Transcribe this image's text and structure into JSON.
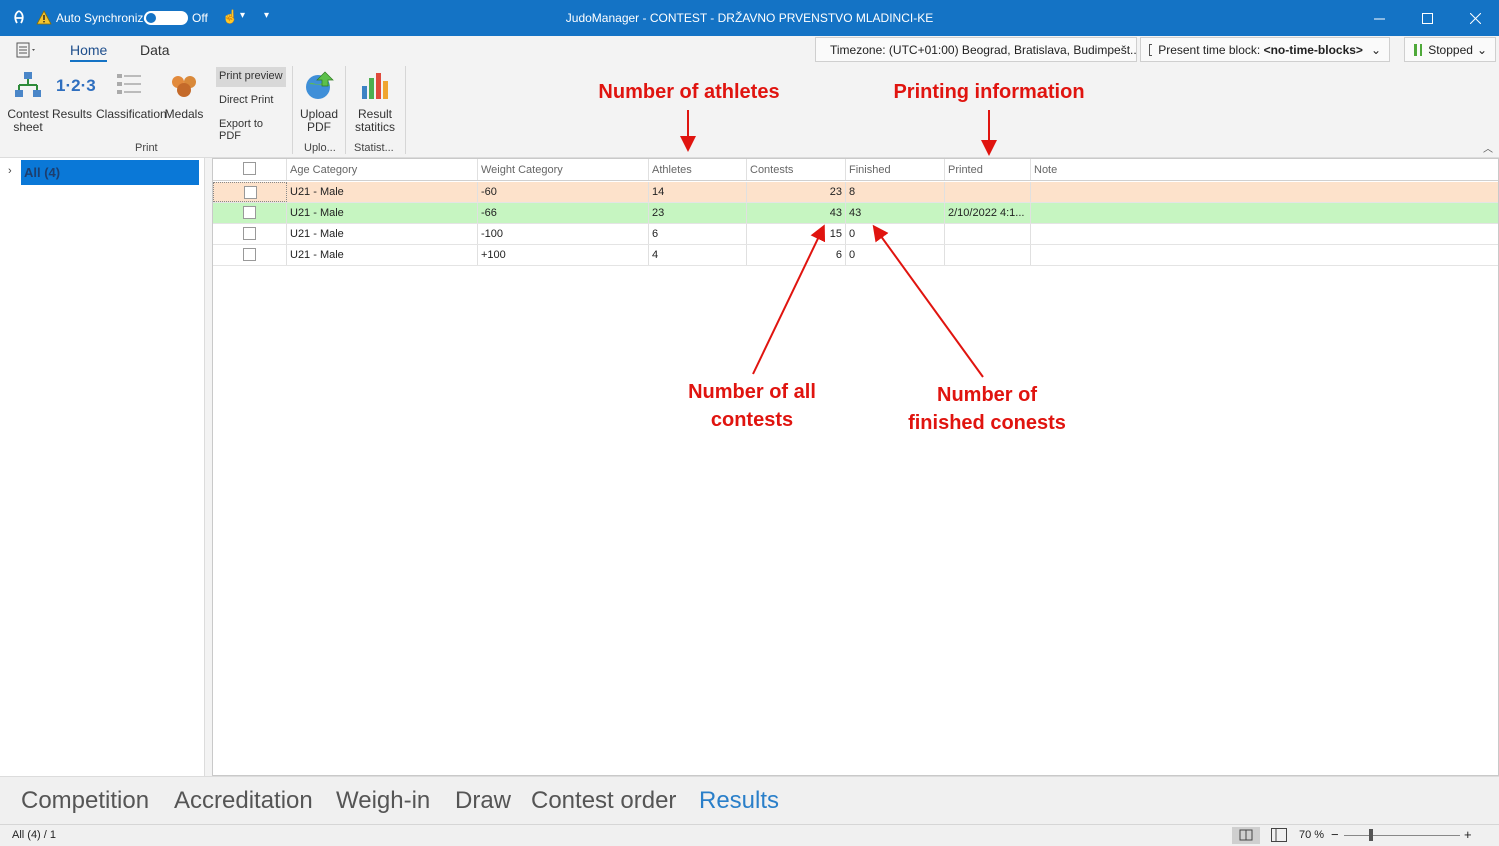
{
  "titlebar": {
    "auto_sync_label": "Auto Synchronize",
    "auto_sync_state": "Off",
    "title": "JudoManager - CONTEST - DRŽAVNO PRVENSTVO MLADINCI-KE"
  },
  "ribbon": {
    "tabs": [
      "Home",
      "Data"
    ],
    "timezone": "Timezone: (UTC+01:00) Beograd, Bratislava, Budimpešt...",
    "time_block_label": "Present time block:",
    "time_block_value": "<no-time-blocks>",
    "status": "Stopped",
    "print_group": {
      "caption": "Print",
      "buttons": [
        "Contest sheet",
        "Results",
        "Classification",
        "Medals"
      ],
      "options": [
        "Print preview",
        "Direct Print",
        "Export to PDF"
      ]
    },
    "upload_group": {
      "caption": "Uplo...",
      "button": "Upload PDF"
    },
    "stats_group": {
      "caption": "Statist...",
      "button": "Result statitics"
    }
  },
  "tree": {
    "item": "All (4)"
  },
  "grid": {
    "columns": [
      "Age Category",
      "Weight Category",
      "Athletes",
      "Contests",
      "Finished",
      "Printed",
      "Note"
    ],
    "rows": [
      {
        "age": "U21 - Male",
        "weight": "-60",
        "athletes": "14",
        "contests": "23",
        "finished": "8",
        "printed": "",
        "note": ""
      },
      {
        "age": "U21 - Male",
        "weight": "-66",
        "athletes": "23",
        "contests": "43",
        "finished": "43",
        "printed": "2/10/2022 4:1...",
        "note": ""
      },
      {
        "age": "U21 - Male",
        "weight": "-100",
        "athletes": "6",
        "contests": "15",
        "finished": "0",
        "printed": "",
        "note": ""
      },
      {
        "age": "U21 - Male",
        "weight": "+100",
        "athletes": "4",
        "contests": "6",
        "finished": "0",
        "printed": "",
        "note": ""
      }
    ]
  },
  "annotations": {
    "athletes": "Number of athletes",
    "printing": "Printing information",
    "all_contests_1": "Number of all",
    "all_contests_2": "contests",
    "finished_1": "Number of",
    "finished_2": "finished conests"
  },
  "nav": [
    "Competition",
    "Accreditation",
    "Weigh-in",
    "Draw",
    "Contest order",
    "Results"
  ],
  "statusbar": {
    "left": "All (4) / 1",
    "zoom": "70 %"
  },
  "colors": {
    "titlebar": "#1473c5",
    "row_highlight_orange": "#fde2cb",
    "row_highlight_green": "#c6f5c1",
    "annotation": "#e0140f"
  }
}
